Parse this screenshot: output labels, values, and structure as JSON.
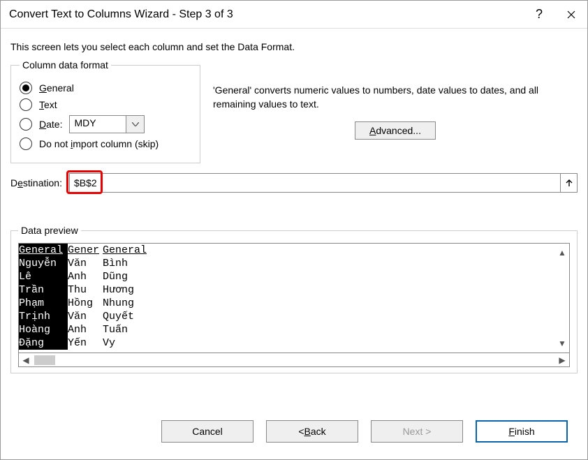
{
  "title": "Convert Text to Columns Wizard - Step 3 of 3",
  "intro": "This screen lets you select each column and set the Data Format.",
  "format": {
    "legend": "Column data format",
    "general": "General",
    "text": "Text",
    "date": "Date:",
    "date_value": "MDY",
    "skip": "Do not import column (skip)"
  },
  "desc": "'General' converts numeric values to numbers, date values to dates, and all remaining values to text.",
  "advanced": "Advanced...",
  "destination_label": "Destination:",
  "destination_value": "$B$2",
  "preview_legend": "Data preview",
  "preview": {
    "headers": [
      "General",
      "General",
      "General"
    ],
    "rows": [
      [
        "Nguyễn",
        "Văn",
        "Bình"
      ],
      [
        "Lê",
        "Anh",
        "Dũng"
      ],
      [
        "Trần",
        "Thu",
        "Hương"
      ],
      [
        "Phạm",
        "Hồng",
        "Nhung"
      ],
      [
        "Trịnh",
        "Văn",
        "Quyết"
      ],
      [
        "Hoàng",
        "Anh",
        "Tuấn"
      ],
      [
        "Đặng",
        "Yến",
        "Vy"
      ]
    ]
  },
  "buttons": {
    "cancel": "Cancel",
    "back": "< Back",
    "next": "Next >",
    "finish": "Finish"
  }
}
